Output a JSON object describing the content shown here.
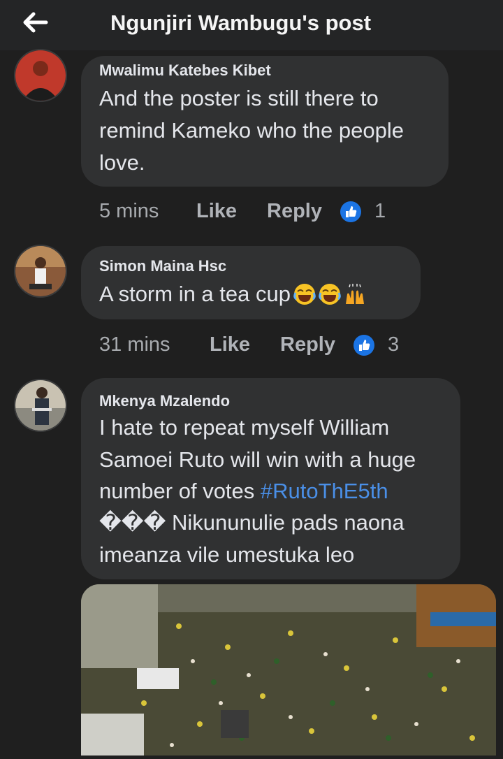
{
  "header": {
    "title": "Ngunjiri Wambugu's post",
    "back_icon": "arrow-left-icon"
  },
  "comments": [
    {
      "author": "Mwalimu Katebes Kibet",
      "lines": [
        "And the poster is still there to",
        "remind Kameko who the people",
        "love."
      ],
      "time": "5 mins",
      "like_label": "Like",
      "reply_label": "Reply",
      "reaction_count": "1"
    },
    {
      "author": "Simon Maina Hsc",
      "text": "A storm in a tea cup",
      "emojis": [
        "face-with-tears-of-joy-icon",
        "face-with-tears-of-joy-icon",
        "raising-hands-icon"
      ],
      "time": "31 mins",
      "like_label": "Like",
      "reply_label": "Reply",
      "reaction_count": "3"
    },
    {
      "author": "Mkenya Mzalendo",
      "line1": "I hate to repeat myself William",
      "line2": "Samoei Ruto will win with a huge",
      "line3_text": "number of votes ",
      "line3_hashtag": "#RutoThE5th",
      "line4_glyphs": "���",
      "line4_text": " Nikununulie pads naona",
      "line5": "imeanza vile umestuka leo"
    }
  ],
  "colors": {
    "background": "#1f1f1f",
    "bubble": "#303132",
    "accent": "#1b74e4",
    "hashtag": "#4a8fe7"
  }
}
